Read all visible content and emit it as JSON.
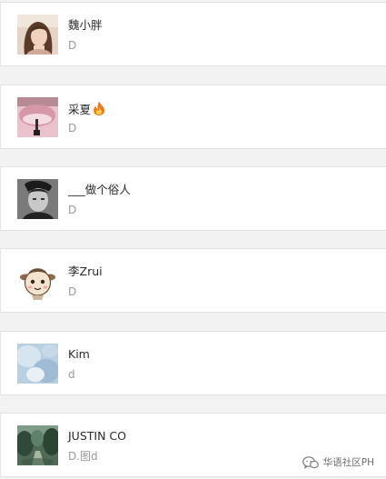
{
  "contacts": [
    {
      "name": "魏小胖",
      "message": "D",
      "avatar": "avatar-woman-selfie"
    },
    {
      "name": "采夏",
      "message": "D",
      "avatar": "avatar-pink-umbrella",
      "badge": "fire-icon"
    },
    {
      "name": "___做个俗人",
      "message": "D",
      "avatar": "avatar-man-portrait"
    },
    {
      "name": "李Zrui",
      "message": "D",
      "avatar": "avatar-cartoon-sheep"
    },
    {
      "name": "Kim",
      "message": "d",
      "avatar": "avatar-blue-photo"
    },
    {
      "name": "JUSTIN CO",
      "message": "D.图d",
      "avatar": "avatar-forest-path"
    }
  ],
  "watermark": {
    "text": "华语社区PH",
    "icon": "wechat-icon"
  }
}
